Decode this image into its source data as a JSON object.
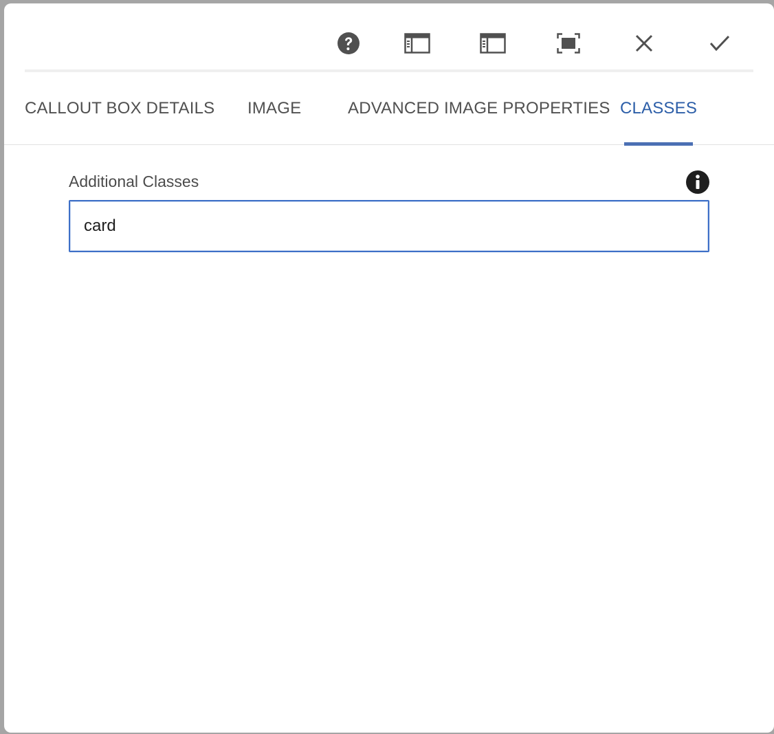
{
  "toolbar": {
    "buttons": [
      {
        "name": "help-button",
        "icon": "help-circle-icon"
      },
      {
        "name": "toggle-side-panel-button",
        "icon": "side-panel-icon"
      },
      {
        "name": "toggle-side-panel-alt-button",
        "icon": "side-panel-icon"
      },
      {
        "name": "fullscreen-button",
        "icon": "fullscreen-icon"
      },
      {
        "name": "cancel-button",
        "icon": "close-icon"
      },
      {
        "name": "done-button",
        "icon": "checkmark-icon"
      }
    ]
  },
  "tabs": [
    {
      "label": "CALLOUT BOX DETAILS",
      "active": false
    },
    {
      "label": "IMAGE",
      "active": false
    },
    {
      "label": "ADVANCED IMAGE PROPERTIES",
      "active": false
    },
    {
      "label": "CLASSES",
      "active": true
    }
  ],
  "form": {
    "additional_classes": {
      "label": "Additional Classes",
      "value": "card",
      "info_icon": "info-icon"
    }
  },
  "colors": {
    "accent": "#2c5ea8",
    "tab_indicator": "#4b70b4",
    "input_focus_border": "#3d6fc7",
    "icon": "#505050"
  }
}
